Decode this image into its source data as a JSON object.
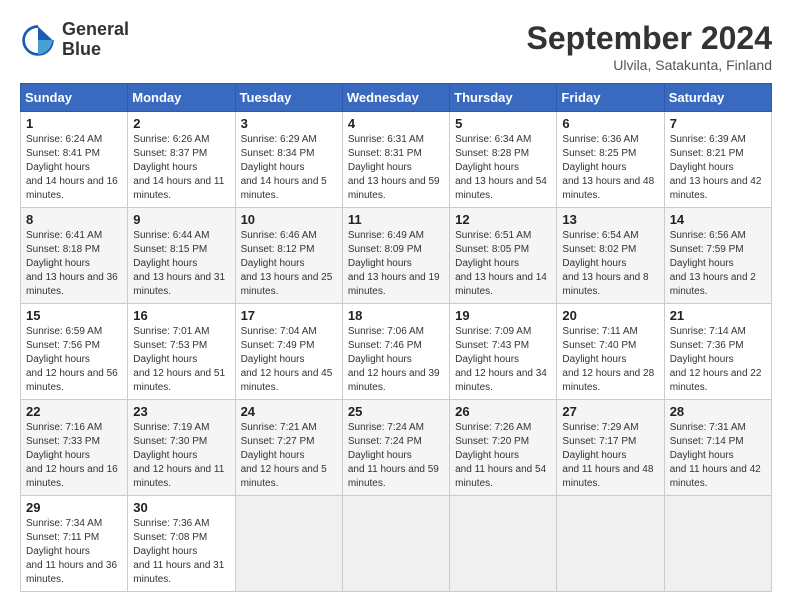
{
  "header": {
    "logo_line1": "General",
    "logo_line2": "Blue",
    "month": "September 2024",
    "location": "Ulvila, Satakunta, Finland"
  },
  "weekdays": [
    "Sunday",
    "Monday",
    "Tuesday",
    "Wednesday",
    "Thursday",
    "Friday",
    "Saturday"
  ],
  "weeks": [
    [
      {
        "day": "1",
        "sunrise": "6:24 AM",
        "sunset": "8:41 PM",
        "daylight": "14 hours and 16 minutes."
      },
      {
        "day": "2",
        "sunrise": "6:26 AM",
        "sunset": "8:37 PM",
        "daylight": "14 hours and 11 minutes."
      },
      {
        "day": "3",
        "sunrise": "6:29 AM",
        "sunset": "8:34 PM",
        "daylight": "14 hours and 5 minutes."
      },
      {
        "day": "4",
        "sunrise": "6:31 AM",
        "sunset": "8:31 PM",
        "daylight": "13 hours and 59 minutes."
      },
      {
        "day": "5",
        "sunrise": "6:34 AM",
        "sunset": "8:28 PM",
        "daylight": "13 hours and 54 minutes."
      },
      {
        "day": "6",
        "sunrise": "6:36 AM",
        "sunset": "8:25 PM",
        "daylight": "13 hours and 48 minutes."
      },
      {
        "day": "7",
        "sunrise": "6:39 AM",
        "sunset": "8:21 PM",
        "daylight": "13 hours and 42 minutes."
      }
    ],
    [
      {
        "day": "8",
        "sunrise": "6:41 AM",
        "sunset": "8:18 PM",
        "daylight": "13 hours and 36 minutes."
      },
      {
        "day": "9",
        "sunrise": "6:44 AM",
        "sunset": "8:15 PM",
        "daylight": "13 hours and 31 minutes."
      },
      {
        "day": "10",
        "sunrise": "6:46 AM",
        "sunset": "8:12 PM",
        "daylight": "13 hours and 25 minutes."
      },
      {
        "day": "11",
        "sunrise": "6:49 AM",
        "sunset": "8:09 PM",
        "daylight": "13 hours and 19 minutes."
      },
      {
        "day": "12",
        "sunrise": "6:51 AM",
        "sunset": "8:05 PM",
        "daylight": "13 hours and 14 minutes."
      },
      {
        "day": "13",
        "sunrise": "6:54 AM",
        "sunset": "8:02 PM",
        "daylight": "13 hours and 8 minutes."
      },
      {
        "day": "14",
        "sunrise": "6:56 AM",
        "sunset": "7:59 PM",
        "daylight": "13 hours and 2 minutes."
      }
    ],
    [
      {
        "day": "15",
        "sunrise": "6:59 AM",
        "sunset": "7:56 PM",
        "daylight": "12 hours and 56 minutes."
      },
      {
        "day": "16",
        "sunrise": "7:01 AM",
        "sunset": "7:53 PM",
        "daylight": "12 hours and 51 minutes."
      },
      {
        "day": "17",
        "sunrise": "7:04 AM",
        "sunset": "7:49 PM",
        "daylight": "12 hours and 45 minutes."
      },
      {
        "day": "18",
        "sunrise": "7:06 AM",
        "sunset": "7:46 PM",
        "daylight": "12 hours and 39 minutes."
      },
      {
        "day": "19",
        "sunrise": "7:09 AM",
        "sunset": "7:43 PM",
        "daylight": "12 hours and 34 minutes."
      },
      {
        "day": "20",
        "sunrise": "7:11 AM",
        "sunset": "7:40 PM",
        "daylight": "12 hours and 28 minutes."
      },
      {
        "day": "21",
        "sunrise": "7:14 AM",
        "sunset": "7:36 PM",
        "daylight": "12 hours and 22 minutes."
      }
    ],
    [
      {
        "day": "22",
        "sunrise": "7:16 AM",
        "sunset": "7:33 PM",
        "daylight": "12 hours and 16 minutes."
      },
      {
        "day": "23",
        "sunrise": "7:19 AM",
        "sunset": "7:30 PM",
        "daylight": "12 hours and 11 minutes."
      },
      {
        "day": "24",
        "sunrise": "7:21 AM",
        "sunset": "7:27 PM",
        "daylight": "12 hours and 5 minutes."
      },
      {
        "day": "25",
        "sunrise": "7:24 AM",
        "sunset": "7:24 PM",
        "daylight": "11 hours and 59 minutes."
      },
      {
        "day": "26",
        "sunrise": "7:26 AM",
        "sunset": "7:20 PM",
        "daylight": "11 hours and 54 minutes."
      },
      {
        "day": "27",
        "sunrise": "7:29 AM",
        "sunset": "7:17 PM",
        "daylight": "11 hours and 48 minutes."
      },
      {
        "day": "28",
        "sunrise": "7:31 AM",
        "sunset": "7:14 PM",
        "daylight": "11 hours and 42 minutes."
      }
    ],
    [
      {
        "day": "29",
        "sunrise": "7:34 AM",
        "sunset": "7:11 PM",
        "daylight": "11 hours and 36 minutes."
      },
      {
        "day": "30",
        "sunrise": "7:36 AM",
        "sunset": "7:08 PM",
        "daylight": "11 hours and 31 minutes."
      },
      null,
      null,
      null,
      null,
      null
    ]
  ]
}
